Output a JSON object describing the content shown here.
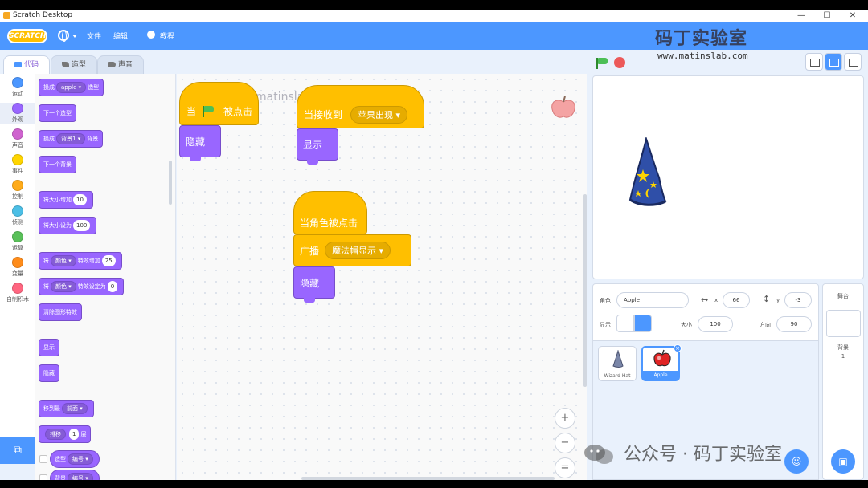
{
  "window": {
    "title": "Scratch Desktop",
    "minimize": "—",
    "maximize": "☐",
    "close": "✕"
  },
  "menu": {
    "logo": "SCRATCH",
    "file": "文件",
    "edit": "编辑",
    "tutorials": "教程"
  },
  "brand": {
    "name": "码丁实验室",
    "site": "www.matinslab.com"
  },
  "tabs": [
    {
      "label": "代码"
    },
    {
      "label": "造型"
    },
    {
      "label": "声音"
    }
  ],
  "categories": [
    {
      "label": "运动",
      "color": "#4c97ff"
    },
    {
      "label": "外观",
      "color": "#9966ff"
    },
    {
      "label": "声音",
      "color": "#cf63cf"
    },
    {
      "label": "事件",
      "color": "#ffd500"
    },
    {
      "label": "控制",
      "color": "#ffab19"
    },
    {
      "label": "侦测",
      "color": "#4cbfe6"
    },
    {
      "label": "运算",
      "color": "#59c059"
    },
    {
      "label": "变量",
      "color": "#ff8c1a"
    },
    {
      "label": "自制积木",
      "color": "#ff6680"
    }
  ],
  "palette": {
    "switch_costume": {
      "a": "换成",
      "dd": "apple",
      "b": "造型"
    },
    "next_costume": "下一个造型",
    "switch_backdrop": {
      "a": "换成",
      "dd": "背景1",
      "b": "背景"
    },
    "next_backdrop": "下一个背景",
    "change_size": {
      "a": "将大小增加",
      "v": "10"
    },
    "set_size": {
      "a": "将大小设为",
      "v": "100"
    },
    "change_effect": {
      "a": "将",
      "dd": "颜色",
      "b": "特效增加",
      "v": "25"
    },
    "set_effect": {
      "a": "将",
      "dd": "颜色",
      "b": "特效设定为",
      "v": "0"
    },
    "clear_effects": "清除图形特效",
    "show": "显示",
    "hide": "隐藏",
    "go_to_layer": {
      "a": "移到最",
      "dd": "前面"
    },
    "go_layers": {
      "a": "排移",
      "v": "1",
      "b": "层"
    },
    "costume_reporter": {
      "a": "造型",
      "dd": "编号"
    },
    "backdrop_reporter": {
      "a": "背景",
      "dd": "编号"
    }
  },
  "scripts": {
    "s1": {
      "when": "当",
      "clicked": "被点击",
      "hide": "隐藏"
    },
    "s2": {
      "receive": "当接收到",
      "message": "苹果出现",
      "show": "显示"
    },
    "s3": {
      "sprite_clicked": "当角色被点击",
      "broadcast": "广播",
      "message": "魔法帽显示",
      "hide": "隐藏"
    }
  },
  "watermark_code": "matinslab.com-admin",
  "zoom": {
    "in": "+",
    "out": "−",
    "reset": "="
  },
  "sprite_info": {
    "label_sprite": "角色",
    "name": "Apple",
    "label_x": "x",
    "x": "66",
    "label_y": "y",
    "y": "-3",
    "label_show": "显示",
    "label_size": "大小",
    "size": "100",
    "label_direction": "方向",
    "direction": "90"
  },
  "sprites": [
    {
      "name": "Wizard Hat"
    },
    {
      "name": "Apple"
    }
  ],
  "stage_panel": {
    "title": "舞台",
    "backdrops_label": "背景",
    "backdrops_count": "1"
  },
  "wechat_watermark": "公众号 · 码丁实验室"
}
